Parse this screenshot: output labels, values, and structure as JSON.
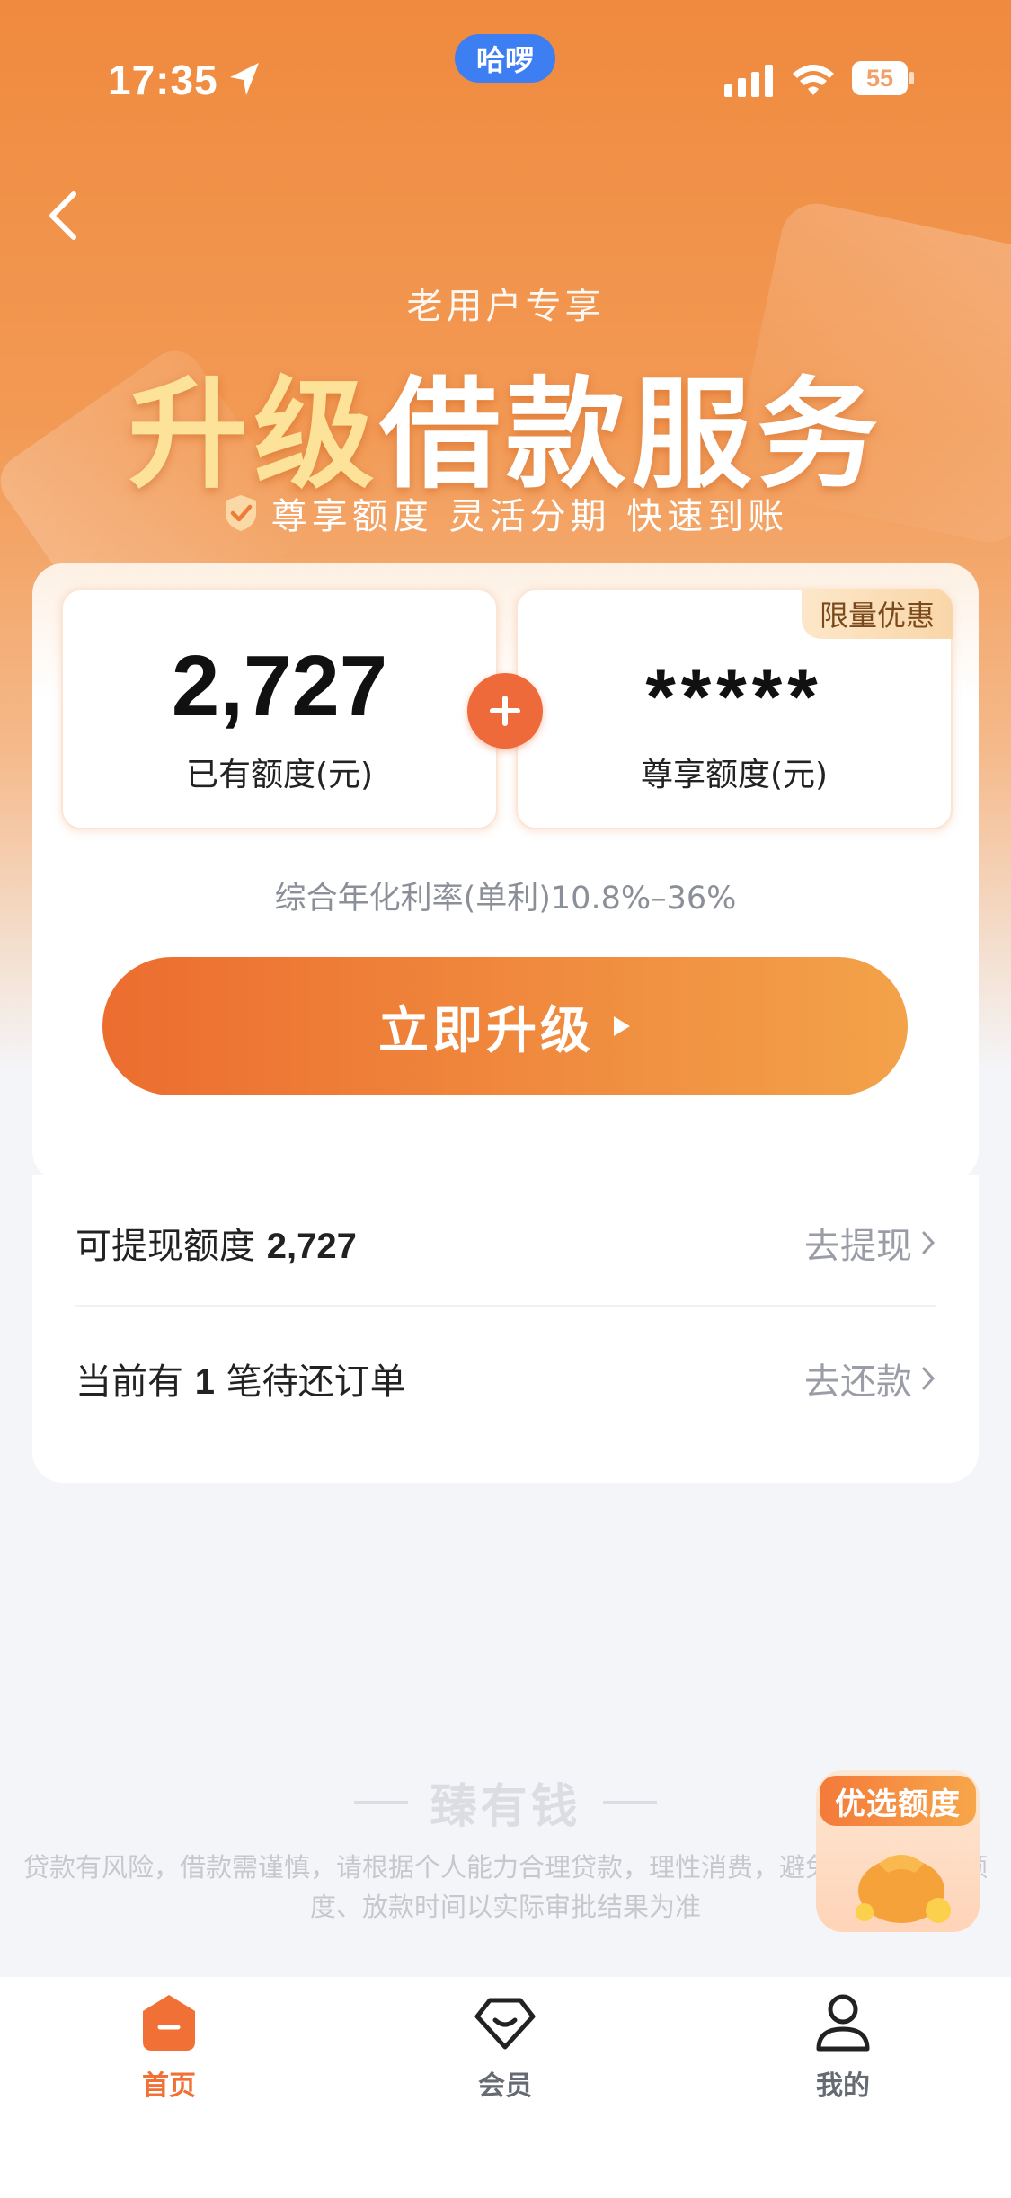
{
  "status_bar": {
    "time": "17:35",
    "pill": "哈啰",
    "battery": "55"
  },
  "hero": {
    "eyebrow": "老用户专享",
    "headline_gold": "升级",
    "headline_white": "借款服务",
    "subline": "尊享额度 灵活分期 快速到账"
  },
  "credit": {
    "existing_value": "2,727",
    "existing_label": "已有额度(元)",
    "exclusive_value": "*****",
    "exclusive_label": "尊享额度(元)",
    "limited_tag": "限量优惠"
  },
  "rate_text": "综合年化利率(单利)10.8%–36%",
  "upgrade_button": "立即升级",
  "info": {
    "withdraw_label": "可提现额度",
    "withdraw_amount": "2,727",
    "withdraw_action": "去提现",
    "orders_prefix": "当前有",
    "orders_count": "1",
    "orders_suffix": "笔待还订单",
    "repay_action": "去还款"
  },
  "footer": {
    "brand": "臻有钱",
    "disclaimer": "贷款有风险，借款需谨慎，请根据个人能力合理贷款，理性消费，避免逾期。贷款额度、放款时间以实际审批结果为准"
  },
  "promo_badge": "优选额度",
  "nav": {
    "home": "首页",
    "member": "会员",
    "mine": "我的"
  },
  "colors": {
    "brand_orange": "#ee6a3a",
    "accent_gold": "#fde39a",
    "status_pill": "#3d7ff2"
  },
  "icons": [
    "location-arrow-icon",
    "signal-icon",
    "wifi-icon",
    "battery-icon",
    "back-arrow-icon",
    "shield-check-icon",
    "plus-icon",
    "play-triangle-icon",
    "chevron-right-icon",
    "home-icon",
    "diamond-icon",
    "person-icon",
    "money-bag-icon"
  ]
}
